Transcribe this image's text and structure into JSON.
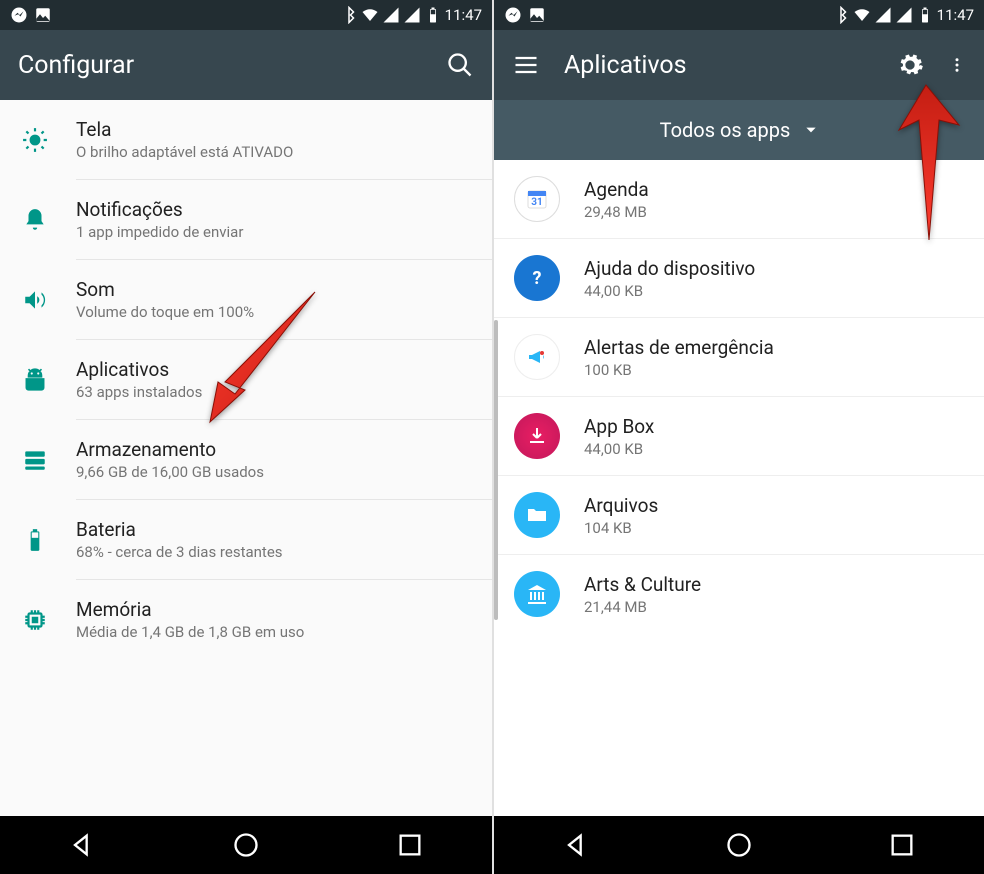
{
  "status": {
    "time": "11:47"
  },
  "left": {
    "title": "Configurar",
    "items": [
      {
        "title": "Tela",
        "sub": "O brilho adaptável está ATIVADO"
      },
      {
        "title": "Notificações",
        "sub": "1 app impedido de enviar"
      },
      {
        "title": "Som",
        "sub": "Volume do toque em 100%"
      },
      {
        "title": "Aplicativos",
        "sub": "63 apps instalados"
      },
      {
        "title": "Armazenamento",
        "sub": "9,66 GB de 16,00 GB usados"
      },
      {
        "title": "Bateria",
        "sub": "68% - cerca de 3 dias restantes"
      },
      {
        "title": "Memória",
        "sub": "Média de 1,4 GB de 1,8 GB em uso"
      }
    ]
  },
  "right": {
    "title": "Aplicativos",
    "filter": "Todos os apps",
    "apps": [
      {
        "name": "Agenda",
        "size": "29,48 MB"
      },
      {
        "name": "Ajuda do dispositivo",
        "size": "44,00 KB"
      },
      {
        "name": "Alertas de emergência",
        "size": "100 KB"
      },
      {
        "name": "App Box",
        "size": "44,00 KB"
      },
      {
        "name": "Arquivos",
        "size": "104 KB"
      },
      {
        "name": "Arts & Culture",
        "size": "21,44 MB"
      }
    ]
  }
}
